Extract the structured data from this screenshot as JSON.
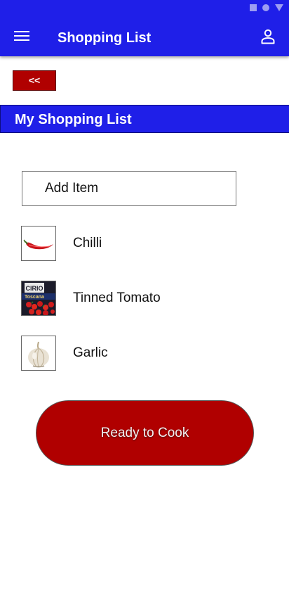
{
  "status_bar": {
    "icons": [
      "square-icon",
      "circle-icon",
      "triangle-icon"
    ]
  },
  "app_bar": {
    "title": "Shopping List",
    "menu_icon": "hamburger-menu-icon",
    "account_icon": "person-icon",
    "background": "#1f1fe8"
  },
  "back_button": {
    "label": "<<",
    "background": "#b00000"
  },
  "section": {
    "title": "My Shopping List"
  },
  "add_item": {
    "label": "Add Item"
  },
  "items": [
    {
      "label": "Chilli",
      "icon": "chilli-image"
    },
    {
      "label": "Tinned Tomato",
      "icon": "tinned-tomato-image",
      "can_brand": "CIRIO",
      "can_text": "Toscana"
    },
    {
      "label": "Garlic",
      "icon": "garlic-image"
    }
  ],
  "cook_button": {
    "label": "Ready to Cook",
    "background": "#b00000"
  }
}
